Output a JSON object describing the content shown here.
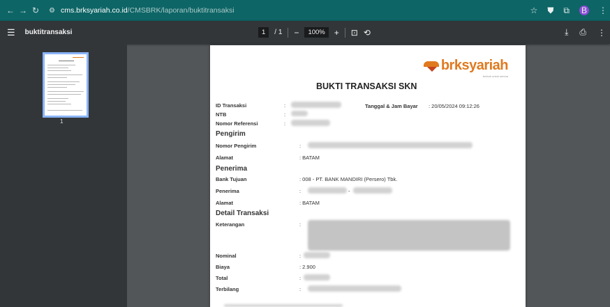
{
  "browser": {
    "url_host": "cms.brksyariah.co.id",
    "url_path": "/CMSBRK/laporan/buktitransaksi",
    "profile_initial": "B"
  },
  "pdf": {
    "title": "buktitransaksi",
    "page_current": "1",
    "page_total": "/ 1",
    "zoom": "100%",
    "thumb_page_number": "1"
  },
  "doc": {
    "logo_text": "brksyariah",
    "logo_tagline": "berkah untuk semua",
    "heading": "BUKTI TRANSAKSI SKN",
    "labels": {
      "id_transaksi": "ID Transaksi",
      "ntb": "NTB",
      "nomor_referensi": "Nomor Referensi",
      "tanggal_jam_bayar": "Tanggal & Jam Bayar",
      "nomor_pengirim": "Nomor Pengirim",
      "alamat": "Alamat",
      "bank_tujuan": "Bank Tujuan",
      "penerima": "Penerima",
      "keterangan": "Keterangan",
      "nominal": "Nominal",
      "biaya": "Biaya",
      "total": "Total",
      "terbilang": "Terbilang"
    },
    "sections": {
      "pengirim": "Pengirim",
      "penerima": "Penerima",
      "detail_transaksi": "Detail Transaksi"
    },
    "values": {
      "colon": ":",
      "tanggal_jam_bayar": ": 20/05/2024 09:12:26",
      "alamat_pengirim": ": BATAM",
      "bank_tujuan": ": 008 - PT. BANK MANDIRI (Persero) Tbk.",
      "alamat_penerima": ": BATAM",
      "biaya": ": 2.900",
      "dash": "-"
    }
  }
}
